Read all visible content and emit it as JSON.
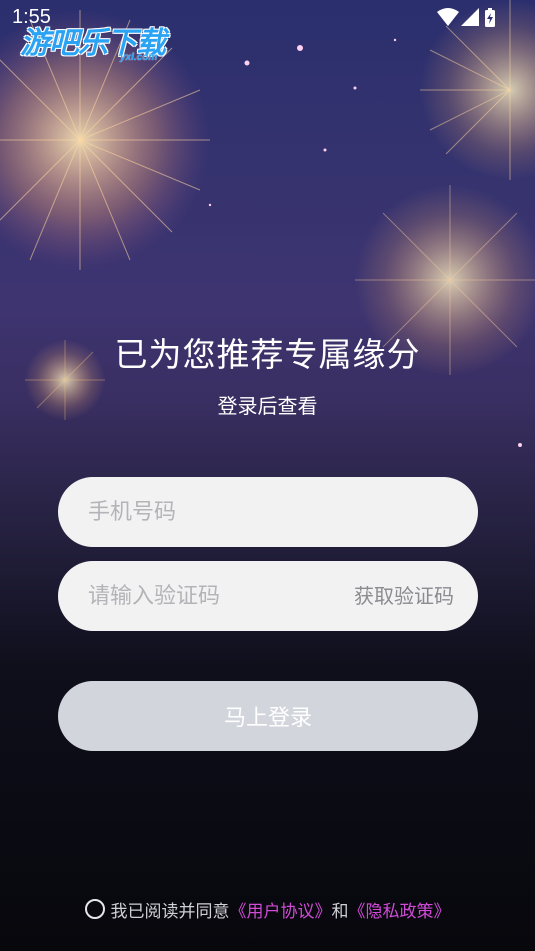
{
  "status_bar": {
    "time": "1:55",
    "icons": [
      "wifi-icon",
      "cellular-signal-icon",
      "battery-charging-icon"
    ]
  },
  "watermark": {
    "title": "游吧乐下载",
    "subtitle": "yxl.com"
  },
  "hero": {
    "title": "已为您推荐专属缘分",
    "subtitle": "登录后查看"
  },
  "form": {
    "phone_placeholder": "手机号码",
    "phone_value": "",
    "code_placeholder": "请输入验证码",
    "code_value": "",
    "get_code_label": "获取验证码",
    "login_label": "马上登录"
  },
  "agreement": {
    "checked": false,
    "text_prefix": "我已阅读并同意",
    "user_agreement": "《用户协议》",
    "conjunction": "和",
    "privacy_policy": "《隐私政策》"
  },
  "colors": {
    "link": "#d04bd6",
    "button_disabled": "#d2d5dc",
    "input_bg": "#f2f2f3",
    "watermark": "#2aa3f4"
  }
}
